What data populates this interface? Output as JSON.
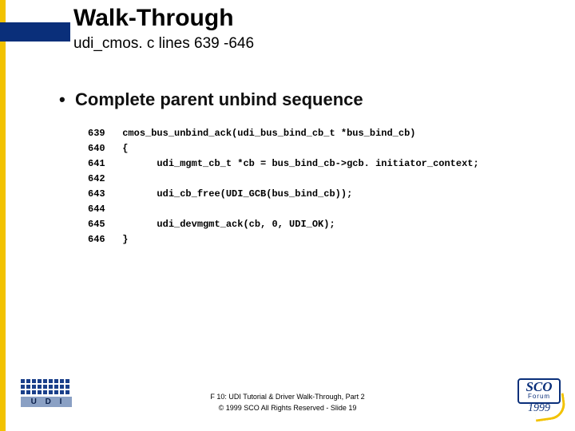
{
  "header": {
    "title": "Walk-Through",
    "subtitle": "udi_cmos. c lines 639 -646"
  },
  "bullet": {
    "marker": "•",
    "text": "Complete parent unbind sequence"
  },
  "code": {
    "lines": [
      {
        "num": "639",
        "text": "cmos_bus_unbind_ack(udi_bus_bind_cb_t *bus_bind_cb)"
      },
      {
        "num": "640",
        "text": "{"
      },
      {
        "num": "641",
        "text": "      udi_mgmt_cb_t *cb = bus_bind_cb->gcb. initiator_context;"
      },
      {
        "num": "642",
        "text": ""
      },
      {
        "num": "643",
        "text": "      udi_cb_free(UDI_GCB(bus_bind_cb));"
      },
      {
        "num": "644",
        "text": ""
      },
      {
        "num": "645",
        "text": "      udi_devmgmt_ack(cb, 0, UDI_OK);"
      },
      {
        "num": "646",
        "text": "}"
      }
    ]
  },
  "footer": {
    "line1": "F 10: UDI Tutorial & Driver Walk-Through, Part 2",
    "line2": "© 1999 SCO  All Rights Reserved - Slide 19"
  },
  "logos": {
    "udi_label": "U D I",
    "sco": "SCO",
    "forum": "Forum",
    "year": "1999"
  }
}
